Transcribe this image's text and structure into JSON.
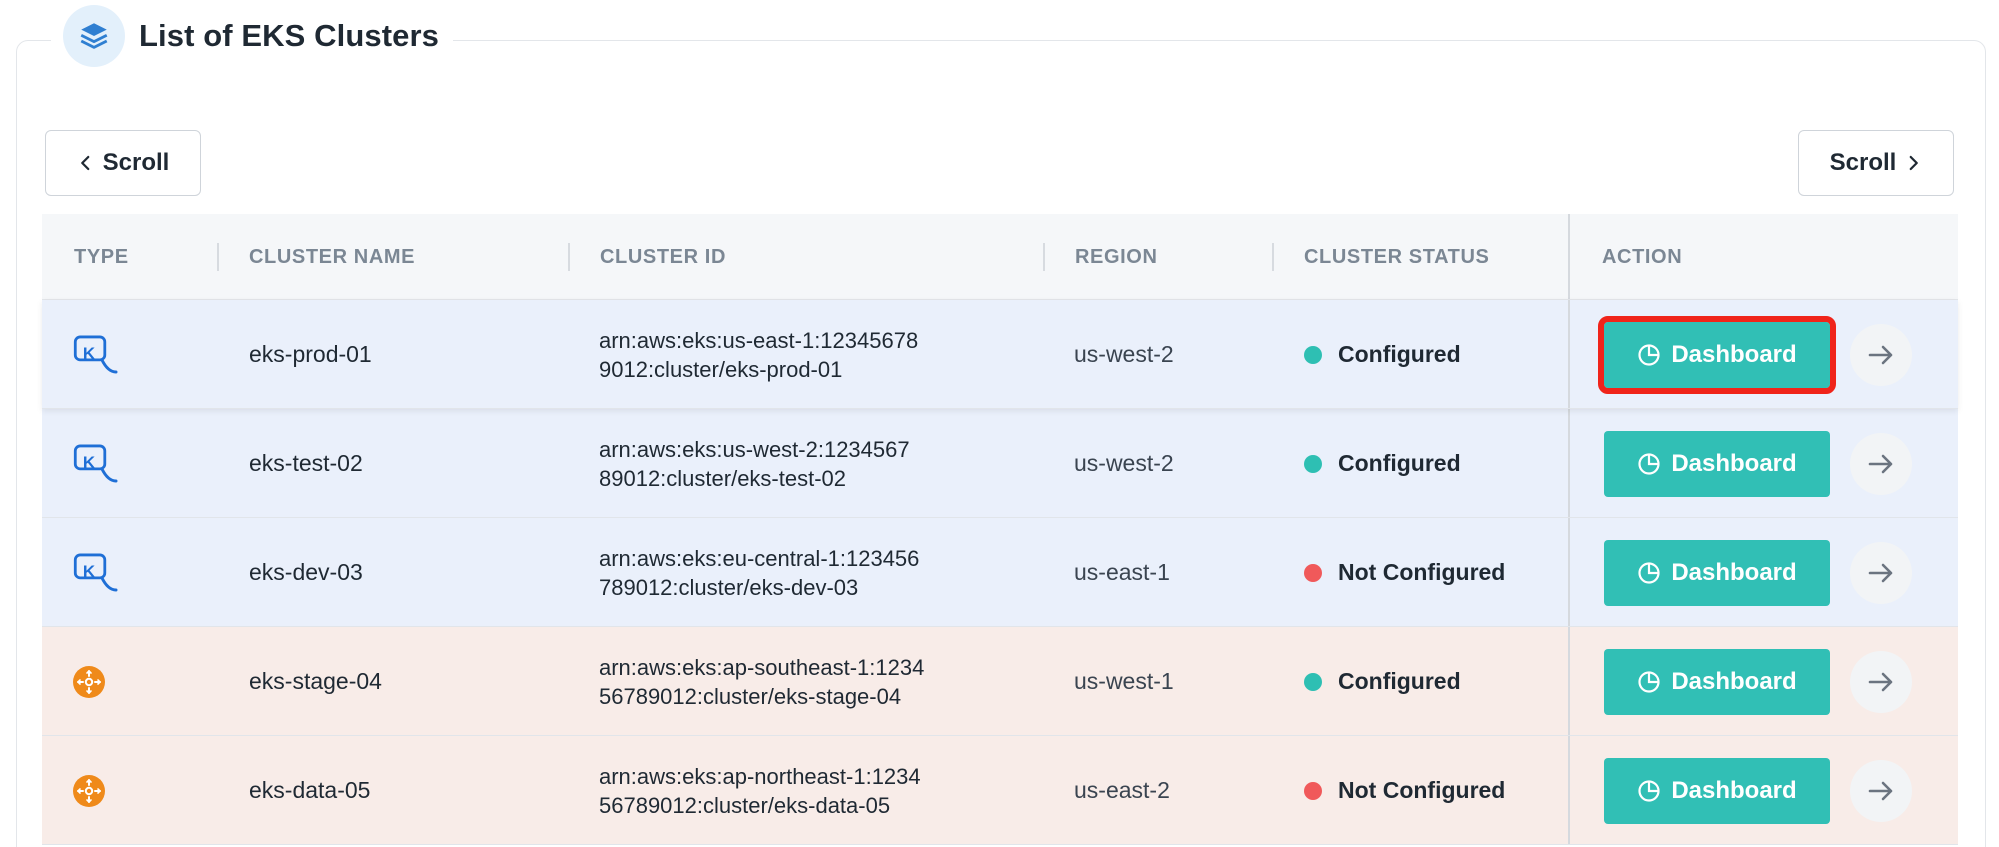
{
  "header": {
    "title": "List of EKS Clusters",
    "icon": "layers-icon"
  },
  "scroll": {
    "left_label": "Scroll",
    "right_label": "Scroll"
  },
  "table": {
    "columns": [
      "TYPE",
      "CLUSTER NAME",
      "CLUSTER ID",
      "REGION",
      "CLUSTER STATUS",
      "ACTION"
    ],
    "rows": [
      {
        "type": "kubernetes",
        "name": "eks-prod-01",
        "id_line1": "arn:aws:eks:us-east-1:12345678",
        "id_line2": "9012:cluster/eks-prod-01",
        "region": "us-west-2",
        "status": "Configured",
        "action": "Dashboard"
      },
      {
        "type": "kubernetes",
        "name": "eks-test-02",
        "id_line1": "arn:aws:eks:us-west-2:1234567",
        "id_line2": "89012:cluster/eks-test-02",
        "region": "us-west-2",
        "status": "Configured",
        "action": "Dashboard"
      },
      {
        "type": "kubernetes",
        "name": "eks-dev-03",
        "id_line1": "arn:aws:eks:eu-central-1:123456",
        "id_line2": "789012:cluster/eks-dev-03",
        "region": "us-east-1",
        "status": "Not Configured",
        "action": "Dashboard"
      },
      {
        "type": "aws",
        "name": "eks-stage-04",
        "id_line1": "arn:aws:eks:ap-southeast-1:1234",
        "id_line2": "56789012:cluster/eks-stage-04",
        "region": "us-west-1",
        "status": "Configured",
        "action": "Dashboard"
      },
      {
        "type": "aws",
        "name": "eks-data-05",
        "id_line1": "arn:aws:eks:ap-northeast-1:1234",
        "id_line2": "56789012:cluster/eks-data-05",
        "region": "us-east-2",
        "status": "Not Configured",
        "action": "Dashboard"
      }
    ]
  },
  "colors": {
    "configured": "#2ebfb3",
    "not_configured": "#f0595a",
    "dashboard_button": "#31bfb5",
    "selection_outline": "#f0241a",
    "k8s_row_bg": "#eaf0fb",
    "aws_row_bg": "#f8ece8"
  }
}
